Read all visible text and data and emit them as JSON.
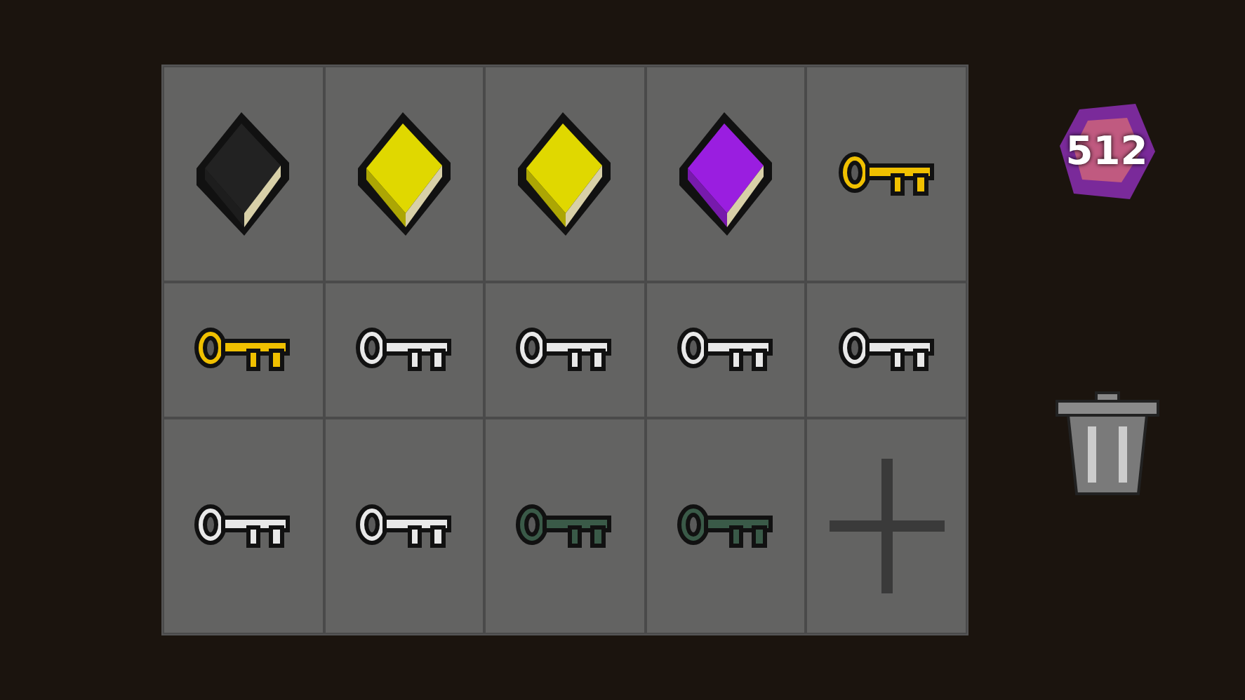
{
  "inventory": {
    "slots": [
      {
        "kind": "book",
        "color": "#222222"
      },
      {
        "kind": "book",
        "color": "#e0d800"
      },
      {
        "kind": "book",
        "color": "#e0d800"
      },
      {
        "kind": "book",
        "color": "#9a1ee0"
      },
      {
        "kind": "key",
        "color": "#f0c000"
      },
      {
        "kind": "key",
        "color": "#f0c000"
      },
      {
        "kind": "key",
        "color": "#e8e8e8"
      },
      {
        "kind": "key",
        "color": "#e8e8e8"
      },
      {
        "kind": "key",
        "color": "#e8e8e8"
      },
      {
        "kind": "key",
        "color": "#e8e8e8"
      },
      {
        "kind": "key",
        "color": "#e8e8e8"
      },
      {
        "kind": "key",
        "color": "#e8e8e8"
      },
      {
        "kind": "key",
        "color": "#3a5a48"
      },
      {
        "kind": "key",
        "color": "#3a5a48"
      },
      {
        "kind": "add"
      }
    ]
  },
  "gems": {
    "count": "512"
  }
}
